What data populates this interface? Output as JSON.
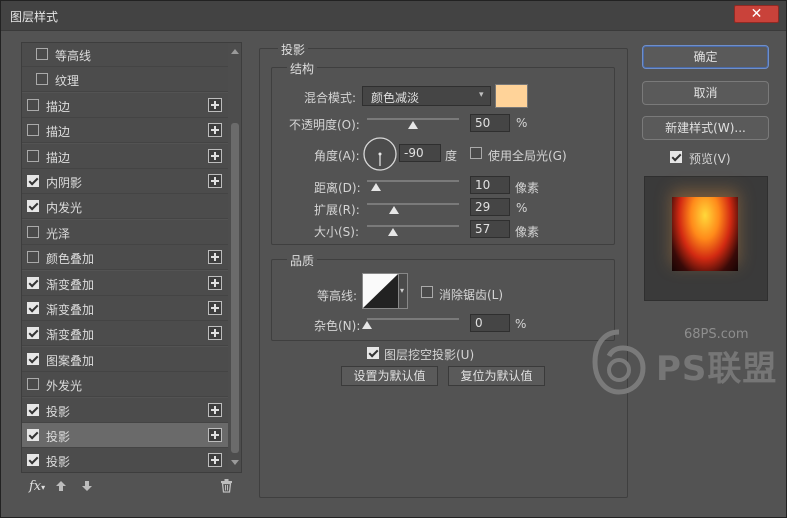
{
  "window": {
    "title": "图层样式",
    "close_glyph": "✕"
  },
  "styles": [
    {
      "label": "等高线",
      "checked": false,
      "indent": true,
      "plus": false
    },
    {
      "label": "纹理",
      "checked": false,
      "indent": true,
      "plus": false
    },
    {
      "label": "描边",
      "checked": false,
      "indent": false,
      "plus": true
    },
    {
      "label": "描边",
      "checked": false,
      "indent": false,
      "plus": true
    },
    {
      "label": "描边",
      "checked": false,
      "indent": false,
      "plus": true
    },
    {
      "label": "内阴影",
      "checked": true,
      "indent": false,
      "plus": true
    },
    {
      "label": "内发光",
      "checked": true,
      "indent": false,
      "plus": false
    },
    {
      "label": "光泽",
      "checked": false,
      "indent": false,
      "plus": false
    },
    {
      "label": "颜色叠加",
      "checked": false,
      "indent": false,
      "plus": true
    },
    {
      "label": "渐变叠加",
      "checked": true,
      "indent": false,
      "plus": true
    },
    {
      "label": "渐变叠加",
      "checked": true,
      "indent": false,
      "plus": true
    },
    {
      "label": "渐变叠加",
      "checked": true,
      "indent": false,
      "plus": true
    },
    {
      "label": "图案叠加",
      "checked": true,
      "indent": false,
      "plus": false
    },
    {
      "label": "外发光",
      "checked": false,
      "indent": false,
      "plus": false
    },
    {
      "label": "投影",
      "checked": true,
      "indent": false,
      "plus": true
    },
    {
      "label": "投影",
      "checked": true,
      "indent": false,
      "plus": true,
      "selected": true
    },
    {
      "label": "投影",
      "checked": true,
      "indent": false,
      "plus": true
    }
  ],
  "bottom_bar": {
    "fx": "fx",
    "fx_caret": "▾",
    "up_icon": "arrow-up-icon",
    "down_icon": "arrow-down-icon",
    "trash_icon": "trash-icon"
  },
  "drop_shadow": {
    "section_title": "投影",
    "structure": {
      "title": "结构",
      "blend_mode_label": "混合模式:",
      "blend_mode_value": "颜色减淡",
      "blend_color": "#ffd399",
      "opacity_label": "不透明度(O):",
      "opacity_value": "50",
      "opacity_unit": "%",
      "angle_label": "角度(A):",
      "angle_value": "-90",
      "angle_unit": "度",
      "global_light_label": "使用全局光(G)",
      "global_light_checked": false,
      "distance_label": "距离(D):",
      "distance_value": "10",
      "distance_unit": "像素",
      "spread_label": "扩展(R):",
      "spread_value": "29",
      "spread_unit": "%",
      "size_label": "大小(S):",
      "size_value": "57",
      "size_unit": "像素"
    },
    "quality": {
      "title": "品质",
      "contour_label": "等高线:",
      "antialias_label": "消除锯齿(L)",
      "antialias_checked": false,
      "noise_label": "杂色(N):",
      "noise_value": "0",
      "noise_unit": "%"
    },
    "knockout_label": "图层挖空投影(U)",
    "knockout_checked": true,
    "make_default": "设置为默认值",
    "reset_default": "复位为默认值"
  },
  "buttons": {
    "ok": "确定",
    "cancel": "取消",
    "new_style": "新建样式(W)...",
    "preview_label": "预览(V)",
    "preview_checked": true
  },
  "watermark": {
    "site": "68PS.com",
    "brand": "PS联盟"
  }
}
